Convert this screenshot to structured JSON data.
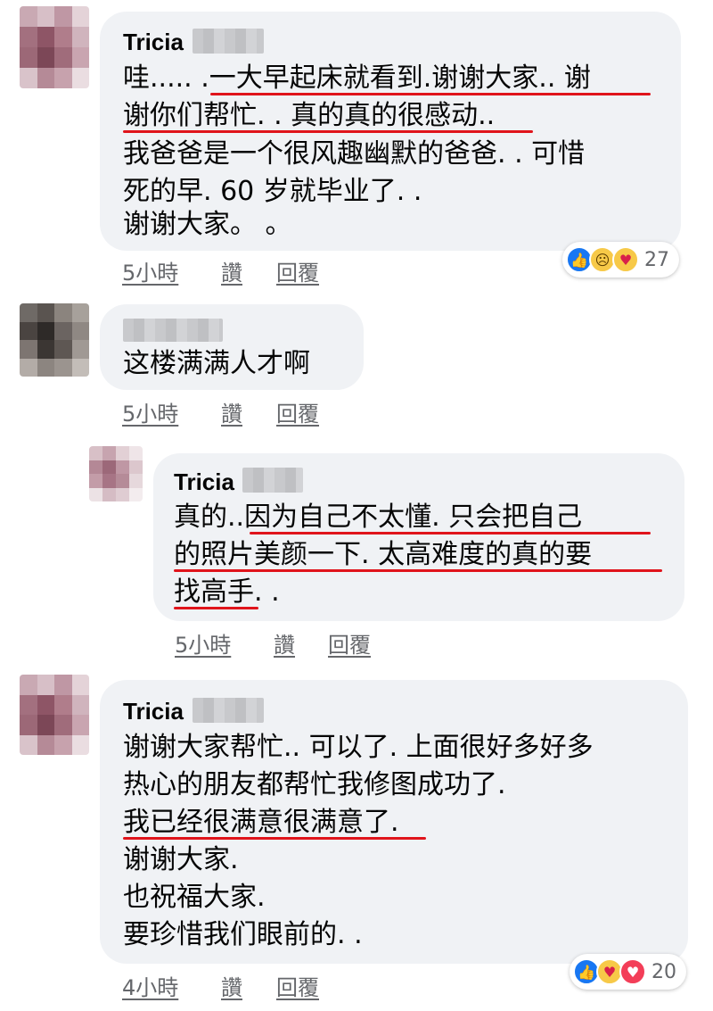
{
  "comments": [
    {
      "author": "Tricia",
      "lines": [
        "哇..... .一大早起床就看到.谢谢大家.. 谢",
        "谢你们帮忙. . 真的真的很感动..",
        "我爸爸是一个很风趣幽默的爸爸. . 可惜",
        "死的早. 60 岁就毕业了. .",
        "谢谢大家。 。"
      ],
      "time": "5小時",
      "like": "讚",
      "reply": "回覆",
      "reaction_icons": [
        "like-icon",
        "sad-icon",
        "care-icon"
      ],
      "reaction_count": "27"
    },
    {
      "author": "",
      "lines": [
        "这楼满满人才啊"
      ],
      "time": "5小時",
      "like": "讚",
      "reply": "回覆"
    },
    {
      "author": "Tricia",
      "lines": [
        "真的..因为自己不太懂. 只会把自己",
        "的照片美颜一下. 太高难度的真的要",
        "找高手. ."
      ],
      "time": "5小時",
      "like": "讚",
      "reply": "回覆"
    },
    {
      "author": "Tricia",
      "lines": [
        "谢谢大家帮忙.. 可以了. 上面很好多好多",
        "热心的朋友都帮忙我修图成功了.",
        "我已经很满意很满意了.",
        "谢谢大家.",
        "也祝福大家.",
        "要珍惜我们眼前的. ."
      ],
      "time": "4小時",
      "like": "讚",
      "reply": "回覆",
      "reaction_icons": [
        "like-icon",
        "care-icon",
        "love-icon"
      ],
      "reaction_count": "20"
    }
  ],
  "colors": {
    "bubble": "#f0f2f5",
    "underline": "#e0141b",
    "meta": "#65676b"
  }
}
